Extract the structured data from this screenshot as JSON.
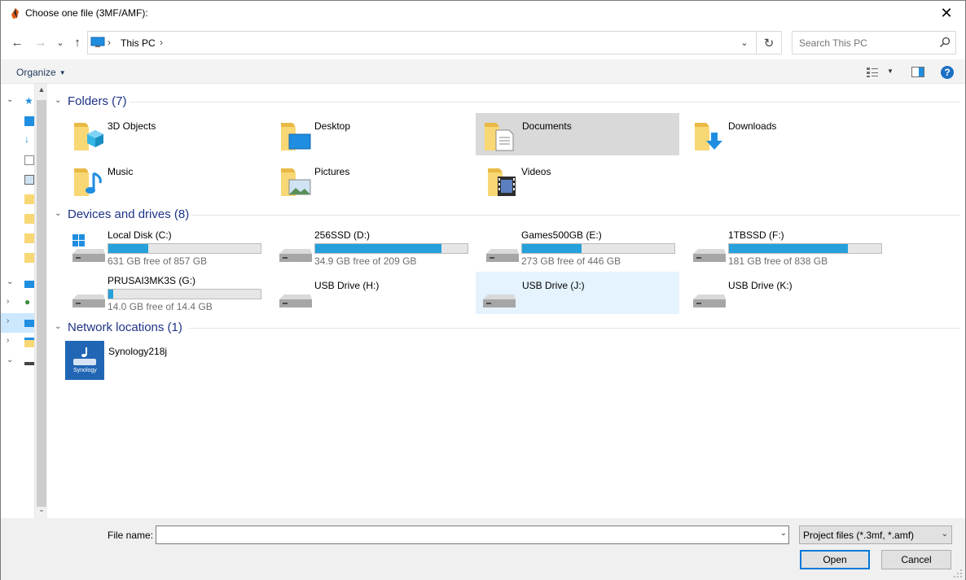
{
  "window": {
    "title": "Choose one file (3MF/AMF):",
    "close_symbol": "✕"
  },
  "navigation": {
    "back_symbol": "←",
    "forward_symbol": "→",
    "recent_symbol": "⌄",
    "up_symbol": "↑"
  },
  "address": {
    "location": "This PC",
    "separator": "›",
    "dropdown_symbol": "⌄",
    "refresh_symbol": "↻"
  },
  "search": {
    "placeholder": "Search This PC"
  },
  "toolbar": {
    "organize_label": "Organize",
    "caret": "▼",
    "help_symbol": "?"
  },
  "groups": {
    "folders": {
      "title": "Folders (7)"
    },
    "drives": {
      "title": "Devices and drives (8)"
    },
    "network": {
      "title": "Network locations (1)"
    }
  },
  "folders": [
    {
      "name": "3D Objects",
      "icon": "3d-objects-folder-icon"
    },
    {
      "name": "Desktop",
      "icon": "desktop-folder-icon"
    },
    {
      "name": "Documents",
      "icon": "documents-folder-icon",
      "selected": true
    },
    {
      "name": "Downloads",
      "icon": "downloads-folder-icon"
    },
    {
      "name": "Music",
      "icon": "music-folder-icon"
    },
    {
      "name": "Pictures",
      "icon": "pictures-folder-icon"
    },
    {
      "name": "Videos",
      "icon": "videos-folder-icon"
    }
  ],
  "drives": [
    {
      "name": "Local Disk (C:)",
      "free": "631 GB free of 857 GB",
      "used_fraction": 0.26,
      "system": true
    },
    {
      "name": "256SSD (D:)",
      "free": "34.9 GB free of 209 GB",
      "used_fraction": 0.83
    },
    {
      "name": "Games500GB (E:)",
      "free": "273 GB free of 446 GB",
      "used_fraction": 0.39
    },
    {
      "name": "1TBSSD (F:)",
      "free": "181 GB free of 838 GB",
      "used_fraction": 0.78
    },
    {
      "name": "PRUSAI3MK3S (G:)",
      "free": "14.0 GB free of 14.4 GB",
      "used_fraction": 0.03
    },
    {
      "name": "USB Drive (H:)"
    },
    {
      "name": "USB Drive (J:)",
      "hovered": true
    },
    {
      "name": "USB Drive (K:)"
    }
  ],
  "network_locations": [
    {
      "name": "Synology218j",
      "logo_text": "Synology"
    }
  ],
  "bottom": {
    "file_name_label": "File name:",
    "file_name_value": "",
    "file_type": "Project files (*.3mf, *.amf)",
    "open_label": "Open",
    "cancel_label": "Cancel",
    "dropdown_symbol": "⌄"
  },
  "colors": {
    "accent": "#0078d7",
    "drive_fill": "#26a0da",
    "group_title": "#1e3287",
    "selection_grey": "#d9d9d9",
    "hover_blue": "#e5f3ff"
  }
}
